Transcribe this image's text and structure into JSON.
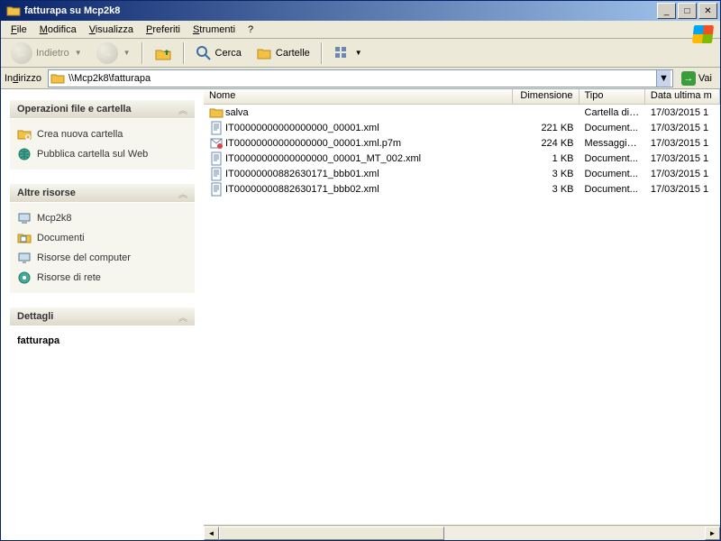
{
  "title": "fatturapa su Mcp2k8",
  "menu": {
    "file": "File",
    "modifica": "Modifica",
    "visualizza": "Visualizza",
    "preferiti": "Preferiti",
    "strumenti": "Strumenti",
    "help": "?"
  },
  "toolbar": {
    "indietro": "Indietro",
    "cerca": "Cerca",
    "cartelle": "Cartelle"
  },
  "address": {
    "label": "Indirizzo",
    "value": "\\\\Mcp2k8\\fatturapa",
    "go": "Vai"
  },
  "panels": {
    "ops": {
      "title": "Operazioni file e cartella",
      "items": [
        "Crea nuova cartella",
        "Pubblica cartella sul Web"
      ]
    },
    "altre": {
      "title": "Altre risorse",
      "items": [
        "Mcp2k8",
        "Documenti",
        "Risorse del computer",
        "Risorse di rete"
      ]
    },
    "dettagli": {
      "title": "Dettagli",
      "name": "fatturapa"
    }
  },
  "columns": {
    "nome": "Nome",
    "dim": "Dimensione",
    "tipo": "Tipo",
    "data": "Data ultima m"
  },
  "colw": {
    "nome": 352,
    "dim": 75,
    "tipo": 75,
    "data": 85
  },
  "files": [
    {
      "icon": "folder",
      "nome": "salva",
      "dim": "",
      "tipo": "Cartella di ...",
      "data": "17/03/2015 1"
    },
    {
      "icon": "xml",
      "nome": "IT00000000000000000_00001.xml",
      "dim": "221 KB",
      "tipo": "Document...",
      "data": "17/03/2015 1"
    },
    {
      "icon": "p7m",
      "nome": "IT00000000000000000_00001.xml.p7m",
      "dim": "224 KB",
      "tipo": "Messaggio...",
      "data": "17/03/2015 1"
    },
    {
      "icon": "xml",
      "nome": "IT00000000000000000_00001_MT_002.xml",
      "dim": "1 KB",
      "tipo": "Document...",
      "data": "17/03/2015 1"
    },
    {
      "icon": "xml",
      "nome": "IT00000000882630171_bbb01.xml",
      "dim": "3 KB",
      "tipo": "Document...",
      "data": "17/03/2015 1"
    },
    {
      "icon": "xml",
      "nome": "IT00000000882630171_bbb02.xml",
      "dim": "3 KB",
      "tipo": "Document...",
      "data": "17/03/2015 1"
    }
  ]
}
